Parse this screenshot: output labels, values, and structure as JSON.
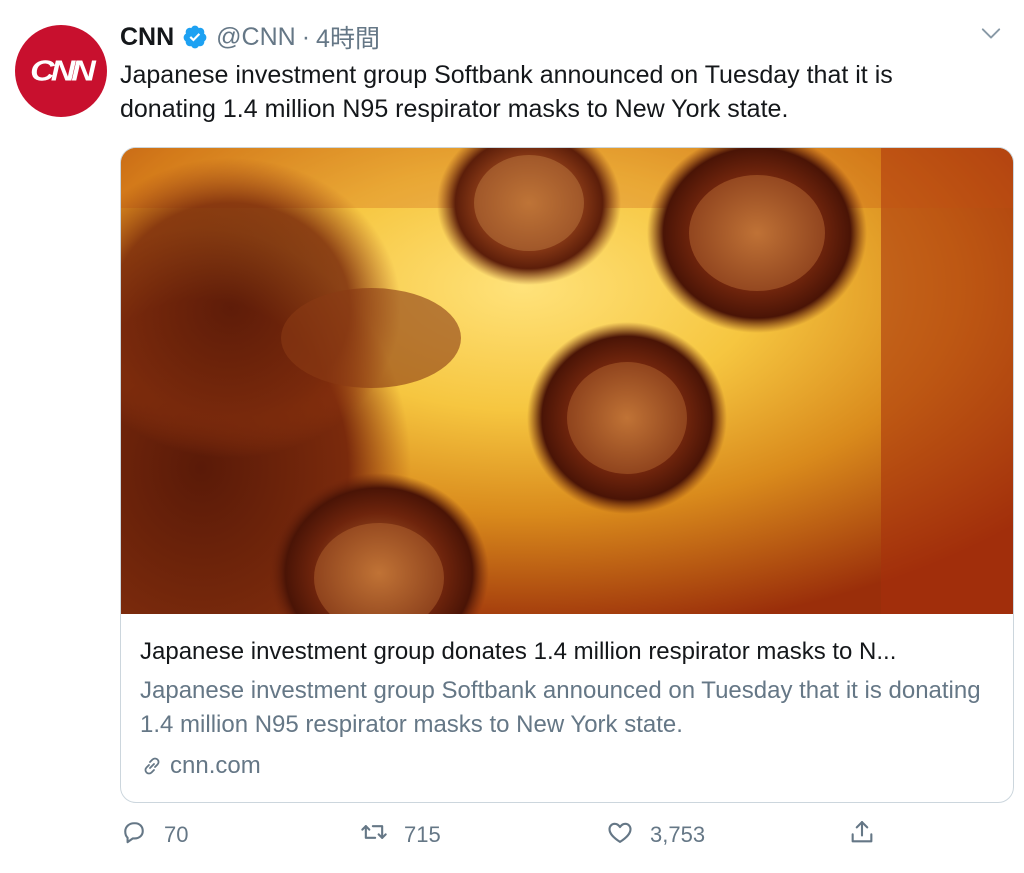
{
  "tweet": {
    "avatar": {
      "logo_text": "CNN",
      "color": "#c8102e"
    },
    "display_name": "CNN",
    "handle": "@CNN",
    "separator": "·",
    "time": "4時間",
    "verified_color": "#1da1f2",
    "text": "Japanese investment group Softbank announced on Tuesday that it is donating 1.4 million N95 respirator masks to New York state."
  },
  "card": {
    "image_icon": "coronavirus-micrograph-image",
    "title": "Japanese investment group donates 1.4 million respirator masks to N...",
    "description": "Japanese investment group Softbank announced on Tuesday that it is donating 1.4 million N95 respirator masks to New York state.",
    "domain": "cnn.com",
    "link_icon": "link-icon"
  },
  "actions": {
    "reply": {
      "icon": "reply-icon",
      "count": "70"
    },
    "retweet": {
      "icon": "retweet-icon",
      "count": "715"
    },
    "like": {
      "icon": "heart-icon",
      "count": "3,753"
    },
    "share": {
      "icon": "share-icon"
    }
  },
  "colors": {
    "text_primary": "#14171a",
    "text_secondary": "#657786",
    "border": "#ccd6dd"
  }
}
